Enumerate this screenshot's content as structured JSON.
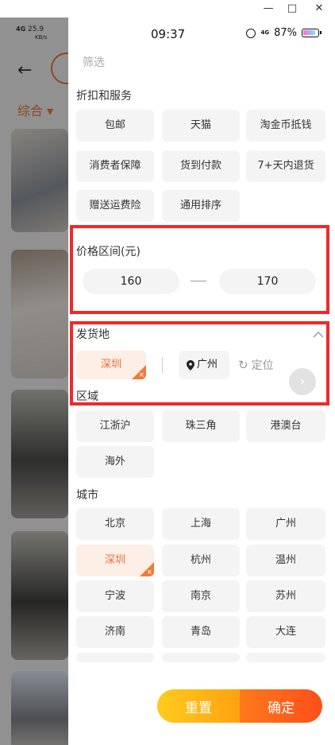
{
  "window": {
    "minimize": "—",
    "maximize": "□",
    "close": "✕"
  },
  "background_app": {
    "status_net": "4G",
    "status_speed": "25.9",
    "status_unit": "KB/s",
    "tab_label": "综合 ▾"
  },
  "status_bar": {
    "time": "09:37",
    "battery": "87%",
    "network": "4G"
  },
  "panel": {
    "title": "筛选",
    "discount_section": {
      "title": "折扣和服务",
      "chips": [
        "包邮",
        "天猫",
        "淘金币抵钱",
        "消费者保障",
        "货到付款",
        "7+天内退货",
        "赠送运费险",
        "通用排序"
      ]
    },
    "price_section": {
      "title": "价格区间(元)",
      "min_value": "160",
      "max_value": "170"
    },
    "ship_from": {
      "title": "发货地",
      "selected": "深圳",
      "current_location": "广州",
      "locate_label": "定位",
      "region_title": "区域",
      "regions": [
        "江浙沪",
        "珠三角",
        "港澳台",
        "海外"
      ],
      "city_title": "城市",
      "cities": [
        "北京",
        "上海",
        "广州",
        "深圳",
        "杭州",
        "温州",
        "宁波",
        "南京",
        "苏州",
        "济南",
        "青岛",
        "大连"
      ],
      "selected_city": "深圳"
    },
    "buttons": {
      "reset": "重置",
      "confirm": "确定"
    }
  },
  "colors": {
    "accent": "#e8703a",
    "highlight_border": "#ee2a2a",
    "reset_gradient": "#ffb616",
    "confirm_gradient": "#ff5a1a"
  }
}
